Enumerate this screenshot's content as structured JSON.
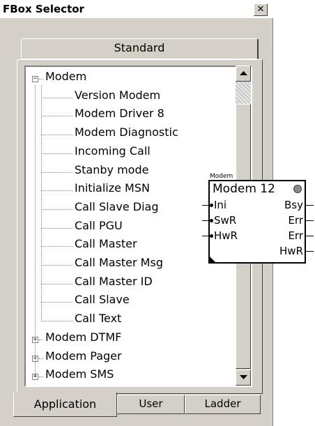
{
  "window": {
    "title": "FBox Selector",
    "close_label": "✕"
  },
  "top_tab": {
    "label": "Standard"
  },
  "tree": {
    "root_label": "Modem",
    "children": [
      "Version Modem",
      "Modem Driver 8",
      "Modem Diagnostic",
      "Incoming Call",
      "Stanby mode",
      "Initialize MSN",
      "Call Slave Diag",
      "Call PGU",
      "Call Master",
      "Call Master Msg",
      "Call Master ID",
      "Call Slave",
      "Call Text"
    ],
    "collapsed": [
      "Modem DTMF",
      "Modem Pager",
      "Modem SMS"
    ]
  },
  "bottom_tabs": [
    {
      "label": "Application",
      "active": true
    },
    {
      "label": "User",
      "active": false
    },
    {
      "label": "Ladder",
      "active": false
    }
  ],
  "fbox_block": {
    "header": "Modem",
    "name": "Modem 12",
    "inputs": [
      "Ini",
      "SwR",
      "HwR"
    ],
    "outputs": [
      "Bsy",
      "Err",
      "Err",
      "HwR"
    ]
  }
}
